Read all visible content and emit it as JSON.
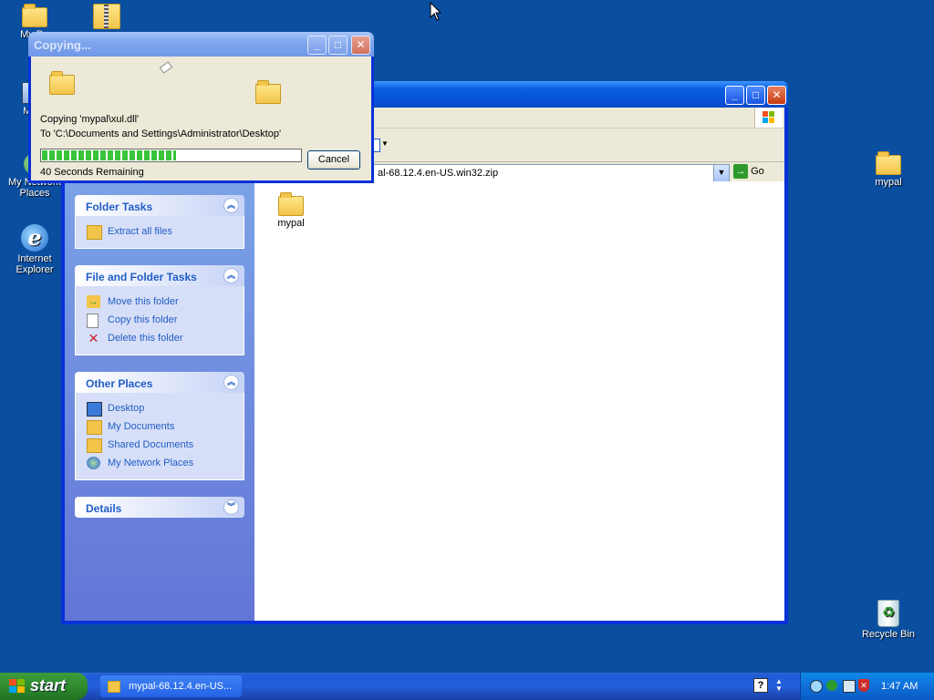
{
  "desktop": {
    "icons": [
      {
        "label": "My Do",
        "icon": "my-documents-icon"
      },
      {
        "label": "My C",
        "icon": "my-computer-icon"
      },
      {
        "label": "My Network Places",
        "icon": "network-places-icon"
      },
      {
        "label": "Internet Explorer",
        "icon": "internet-explorer-icon"
      },
      {
        "label": "mypal",
        "icon": "folder-icon"
      },
      {
        "label": "Recycle Bin",
        "icon": "recycle-bin-icon"
      }
    ]
  },
  "explorer": {
    "address": "al-68.12.4.en-US.win32.zip",
    "go_label": "Go",
    "folder_tasks": {
      "title": "Folder Tasks",
      "items": [
        {
          "label": "Extract all files",
          "icon": "extract-icon"
        }
      ]
    },
    "file_folder_tasks": {
      "title": "File and Folder Tasks",
      "items": [
        {
          "label": "Move this folder",
          "icon": "move-icon"
        },
        {
          "label": "Copy this folder",
          "icon": "copy-icon"
        },
        {
          "label": "Delete this folder",
          "icon": "delete-icon"
        }
      ]
    },
    "other_places": {
      "title": "Other Places",
      "items": [
        {
          "label": "Desktop",
          "icon": "desktop-icon"
        },
        {
          "label": "My Documents",
          "icon": "my-documents-icon"
        },
        {
          "label": "Shared Documents",
          "icon": "shared-documents-icon"
        },
        {
          "label": "My Network Places",
          "icon": "network-places-icon"
        }
      ]
    },
    "details": {
      "title": "Details"
    },
    "content_items": [
      {
        "label": "mypal",
        "icon": "folder-icon"
      }
    ]
  },
  "copy_dialog": {
    "title": "Copying...",
    "copying_line": "Copying 'mypal\\xul.dll'",
    "to_line": "To 'C:\\Documents and Settings\\Administrator\\Desktop'",
    "progress_fraction": 0.52,
    "remaining": "40 Seconds Remaining",
    "cancel_label": "Cancel"
  },
  "taskbar": {
    "start_label": "start",
    "window_button": "mypal-68.12.4.en-US...",
    "clock": "1:47 AM"
  },
  "colors": {
    "desktop": "#0a4ea0",
    "link": "#215dc6",
    "progress": "#39c439",
    "start": "#2f8b2f"
  }
}
